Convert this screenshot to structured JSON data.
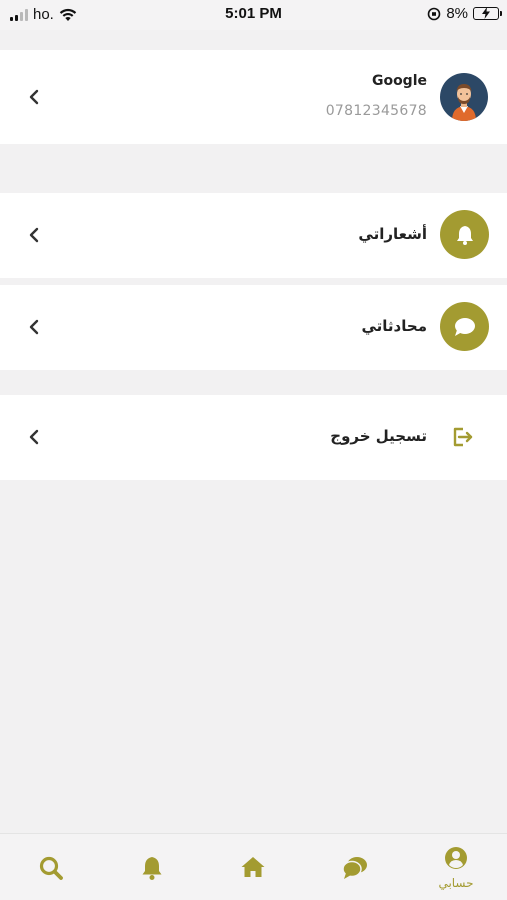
{
  "status_bar": {
    "carrier": "ho.",
    "time": "5:01 PM",
    "battery": "8%"
  },
  "profile": {
    "name": "Google",
    "phone": "07812345678"
  },
  "menu": [
    {
      "label": "أشعاراتي",
      "icon": "bell-icon"
    },
    {
      "label": "محادثاتي",
      "icon": "chat-bubble-icon"
    },
    {
      "label": "تسجيل خروج",
      "icon": "logout-icon"
    }
  ],
  "tabbar": {
    "active_label": "حسابي",
    "tabs": [
      "search-icon",
      "bell-icon",
      "home-icon",
      "chat-icon",
      "account-icon"
    ]
  },
  "colors": {
    "accent": "#a39b31",
    "background": "#f2f1f2",
    "card": "#ffffff"
  }
}
